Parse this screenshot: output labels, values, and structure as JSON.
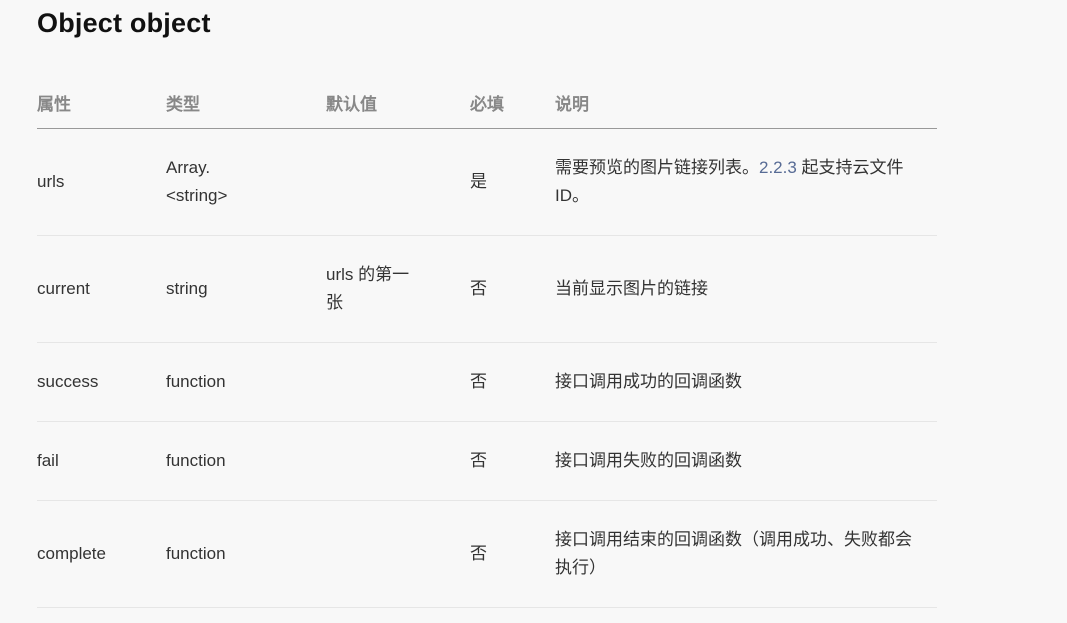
{
  "title": "Object object",
  "table": {
    "headers": [
      "属性",
      "类型",
      "默认值",
      "必填",
      "说明"
    ],
    "rows": [
      {
        "name": "urls",
        "type_line1": "Array.",
        "type_line2": "<string>",
        "default": "",
        "required": "是",
        "desc_pre": "需要预览的图片链接列表。",
        "desc_link": "2.2.3",
        "desc_post": " 起支持云文件ID。"
      },
      {
        "name": "current",
        "type": "string",
        "default_line1": "urls 的第一",
        "default_line2": "张",
        "required": "否",
        "desc": "当前显示图片的链接"
      },
      {
        "name": "success",
        "type": "function",
        "default": "",
        "required": "否",
        "desc": "接口调用成功的回调函数"
      },
      {
        "name": "fail",
        "type": "function",
        "default": "",
        "required": "否",
        "desc": "接口调用失败的回调函数"
      },
      {
        "name": "complete",
        "type": "function",
        "default": "",
        "required": "否",
        "desc": "接口调用结束的回调函数（调用成功、失败都会执行）"
      }
    ]
  }
}
